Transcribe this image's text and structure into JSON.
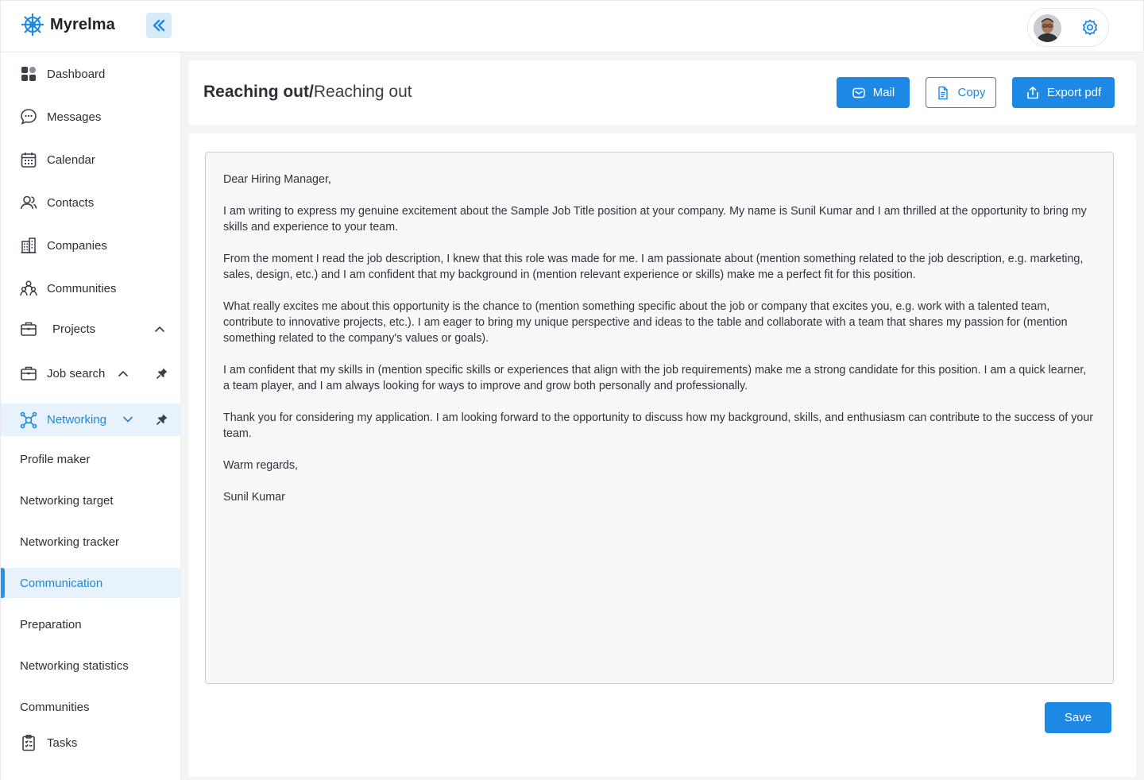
{
  "app": {
    "name": "Myrelma"
  },
  "sidebar": {
    "items": [
      {
        "label": "Dashboard",
        "icon": "dashboard-icon"
      },
      {
        "label": "Messages",
        "icon": "chat-bubble-icon"
      },
      {
        "label": "Calendar",
        "icon": "calendar-icon"
      },
      {
        "label": "Contacts",
        "icon": "contacts-icon"
      },
      {
        "label": "Companies",
        "icon": "building-icon"
      },
      {
        "label": "Communities",
        "icon": "community-icon"
      },
      {
        "label": "Projects",
        "icon": "briefcase-icon",
        "state": "expanded"
      },
      {
        "label": "Job search",
        "icon": "briefcase-icon",
        "state": "expanded"
      },
      {
        "label": "Networking",
        "icon": "network-icon",
        "state": "expanded",
        "active": true
      }
    ],
    "sub_items": [
      {
        "label": "Profile maker"
      },
      {
        "label": "Networking target"
      },
      {
        "label": "Networking tracker"
      },
      {
        "label": "Communication",
        "active": true
      },
      {
        "label": "Preparation"
      },
      {
        "label": "Networking statistics"
      },
      {
        "label": "Communities"
      }
    ],
    "tasks": {
      "label": "Tasks",
      "icon": "clipboard-icon"
    }
  },
  "header": {
    "title_bold": "Reaching out/",
    "title_light": "Reaching out",
    "buttons": {
      "mail": "Mail",
      "copy": "Copy",
      "export": "Export pdf"
    }
  },
  "letter": {
    "paragraphs": [
      "Dear Hiring Manager,",
      "I am writing to express my genuine excitement about the Sample Job Title position at your company. My name is Sunil Kumar and I am thrilled at the opportunity to bring my skills and experience to your team.",
      "From the moment I read the job description, I knew that this role was made for me. I am passionate about (mention something related to the job description, e.g. marketing, sales, design, etc.) and I am confident that my background in (mention relevant experience or skills) make me a perfect fit for this position.",
      "What really excites me about this opportunity is the chance to (mention something specific about the job or company that excites you, e.g. work with a talented team, contribute to innovative projects, etc.). I am eager to bring my unique perspective and ideas to the table and collaborate with a team that shares my passion for (mention something related to the company's values or goals).",
      "I am confident that my skills in (mention specific skills or experiences that align with the job requirements) make me a strong candidate for this position. I am a quick learner, a team player, and I am always looking for ways to improve and grow both personally and professionally.",
      "Thank you for considering my application. I am looking forward to the opportunity to discuss how my background, skills, and enthusiasm can contribute to the success of your team.",
      "Warm regards,",
      "Sunil Kumar"
    ]
  },
  "actions": {
    "save": "Save"
  },
  "colors": {
    "accent": "#1e88e5",
    "active_bg": "#e7f2fc",
    "active_text": "#1e88d9"
  }
}
